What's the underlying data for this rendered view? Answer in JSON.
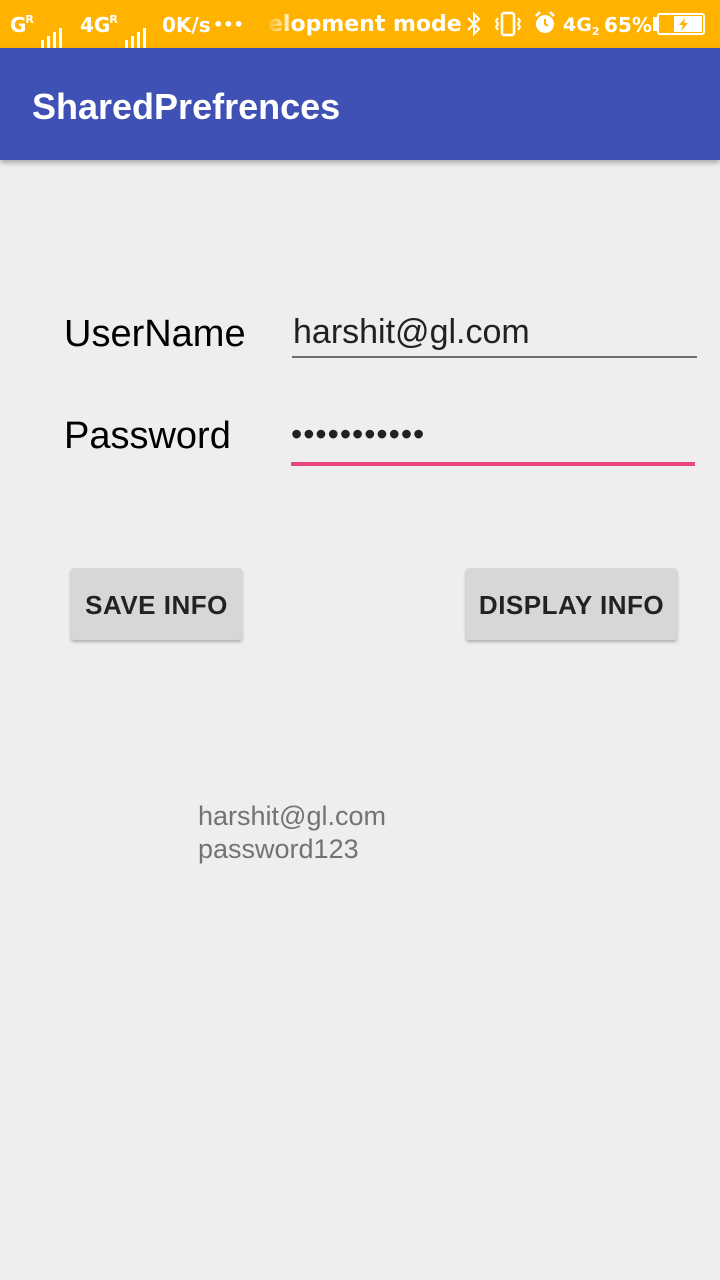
{
  "status_bar": {
    "network1": "G",
    "network1_sup": "R",
    "network2": "4G",
    "network2_sup": "R",
    "speed": "0K/s",
    "more": "•••",
    "notification": "elopment mode",
    "network3": "4G",
    "network3_sub": "2",
    "battery": "65%"
  },
  "app_bar": {
    "title": "SharedPrefrences"
  },
  "form": {
    "username_label": "UserName",
    "username_value": "harshit@gl.com",
    "password_label": "Password",
    "password_value": "•••••••••••"
  },
  "buttons": {
    "save": "SAVE INFO",
    "display": "DISPLAY INFO"
  },
  "output": {
    "line1": "harshit@gl.com",
    "line2": "password123"
  },
  "colors": {
    "status_bar": "#ffb300",
    "app_bar": "#3f51b5",
    "accent": "#e8457a",
    "background": "#eeeeee"
  }
}
